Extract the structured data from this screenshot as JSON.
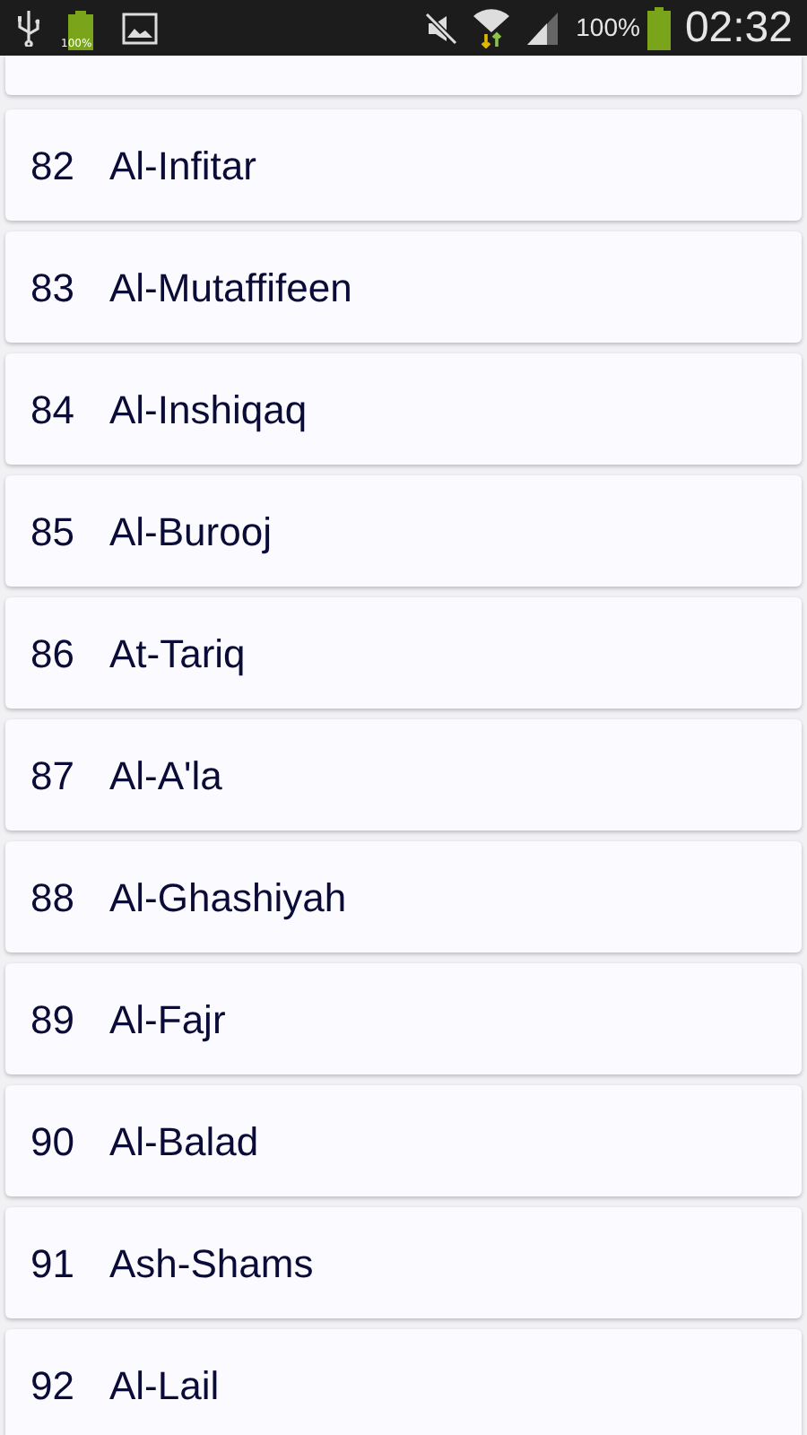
{
  "status_bar": {
    "notification_battery_text": "100%",
    "battery_text": "100%",
    "time": "02:32"
  },
  "surahs": [
    {
      "number": "82",
      "name": "Al-Infitar"
    },
    {
      "number": "83",
      "name": "Al-Mutaffifeen"
    },
    {
      "number": "84",
      "name": "Al-Inshiqaq"
    },
    {
      "number": "85",
      "name": "Al-Burooj"
    },
    {
      "number": "86",
      "name": "At-Tariq"
    },
    {
      "number": "87",
      "name": "Al-A'la"
    },
    {
      "number": "88",
      "name": "Al-Ghashiyah"
    },
    {
      "number": "89",
      "name": "Al-Fajr"
    },
    {
      "number": "90",
      "name": "Al-Balad"
    },
    {
      "number": "91",
      "name": "Ash-Shams"
    },
    {
      "number": "92",
      "name": "Al-Lail"
    }
  ]
}
